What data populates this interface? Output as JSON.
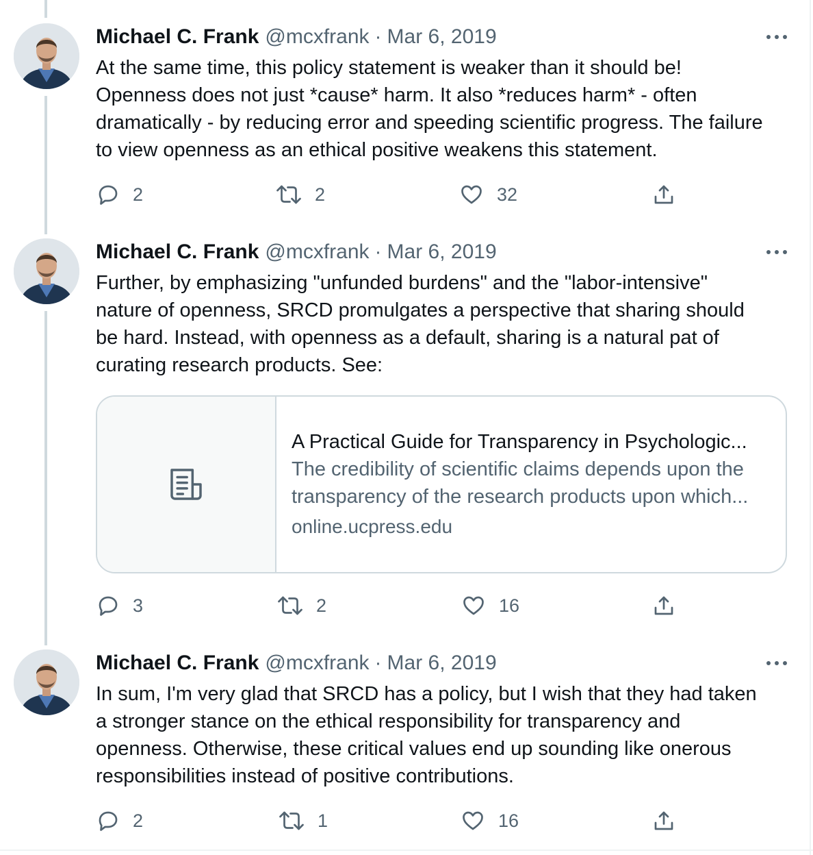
{
  "author": {
    "name": "Michael C. Frank",
    "handle": "@mcxfrank",
    "separator": "·"
  },
  "colors": {
    "text_primary": "#0f1419",
    "text_secondary": "#536471",
    "border": "#cfd9de",
    "thread_line": "#cfd9de"
  },
  "tweets": [
    {
      "date": "Mar 6, 2019",
      "text_lines": [
        "At the same time, this policy statement is weaker than it should be!",
        "Openness does not just *cause* harm. It also *reduces harm* - often",
        "dramatically - by reducing error and speeding scientific progress. The failure",
        "to view openness as an ethical positive weakens this statement."
      ],
      "replies": "2",
      "retweets": "2",
      "likes": "32"
    },
    {
      "date": "Mar 6, 2019",
      "text_lines": [
        "Further, by emphasizing \"unfunded burdens\" and the \"labor-intensive\"",
        "nature of openness, SRCD promulgates a perspective that sharing should",
        "be hard. Instead, with openness as a default, sharing is a natural pat of",
        "curating research products. See:"
      ],
      "card": {
        "icon": "article-icon",
        "title": "A Practical Guide for Transparency in Psychologic...",
        "description_lines": [
          "The credibility of scientific claims depends upon the",
          "transparency of the research products upon which..."
        ],
        "domain": "online.ucpress.edu"
      },
      "replies": "3",
      "retweets": "2",
      "likes": "16"
    },
    {
      "date": "Mar 6, 2019",
      "text_lines": [
        "In sum, I'm very glad that SRCD has a policy, but I wish that they had taken",
        "a stronger stance on the ethical responsibility for transparency and",
        "openness. Otherwise, these critical values end up sounding like onerous",
        "responsibilities instead of positive contributions."
      ],
      "replies": "2",
      "retweets": "1",
      "likes": "16"
    }
  ],
  "icons": {
    "more": "more-dots-icon",
    "reply": "reply-icon",
    "retweet": "retweet-icon",
    "like": "heart-icon",
    "share": "share-icon"
  }
}
